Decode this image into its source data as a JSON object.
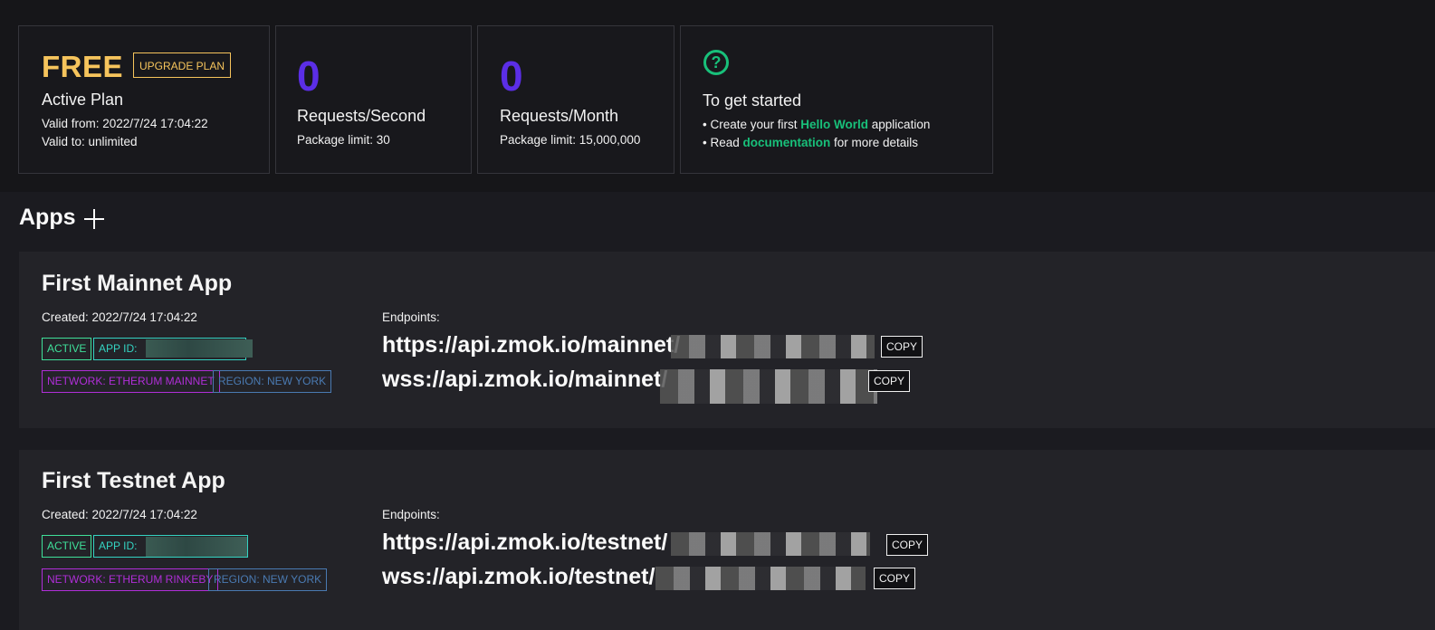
{
  "plan": {
    "name": "FREE",
    "upgrade_label": "UPGRADE PLAN",
    "heading": "Active Plan",
    "valid_from": "Valid from: 2022/7/24 17:04:22",
    "valid_to": "Valid to: unlimited"
  },
  "rps": {
    "value": "0",
    "label": "Requests/Second",
    "limit": "Package limit: 30"
  },
  "rpm": {
    "value": "0",
    "label": "Requests/Month",
    "limit": "Package limit: 15,000,000"
  },
  "getting_started": {
    "heading": "To get started",
    "line1_prefix": "• Create your first ",
    "line1_link": "Hello World",
    "line1_suffix": " application",
    "line2_prefix": "• Read ",
    "line2_link": "documentation",
    "line2_suffix": " for more details",
    "icon": "question-circle-icon",
    "accent_color": "#18c07a"
  },
  "apps_section": {
    "title": "Apps",
    "add_icon": "plus-icon"
  },
  "apps": [
    {
      "name": "First Mainnet App",
      "created": "Created: 2022/7/24 17:04:22",
      "status": "ACTIVE",
      "app_id_label": "APP ID:",
      "network": "NETWORK: ETHERUM MAINNET",
      "region": "REGION: NEW YORK",
      "endpoints_label": "Endpoints:",
      "https_endpoint": "https://api.zmok.io/mainnet/",
      "wss_endpoint": "wss://api.zmok.io/mainnet/",
      "copy_label": "COPY"
    },
    {
      "name": "First Testnet App",
      "created": "Created: 2022/7/24 17:04:22",
      "status": "ACTIVE",
      "app_id_label": "APP ID:",
      "network": "NETWORK: ETHERUM RINKEBY",
      "region": "REGION: NEW YORK",
      "endpoints_label": "Endpoints:",
      "https_endpoint": "https://api.zmok.io/testnet/",
      "wss_endpoint": "wss://api.zmok.io/testnet/",
      "copy_label": "COPY"
    }
  ],
  "colors": {
    "plan_accent": "#f6c45c",
    "stat_number": "#5b2ee6",
    "active_tag": "#3fe09a",
    "network_tag": "#b02ed8",
    "region_tag": "#4a7ab2"
  }
}
